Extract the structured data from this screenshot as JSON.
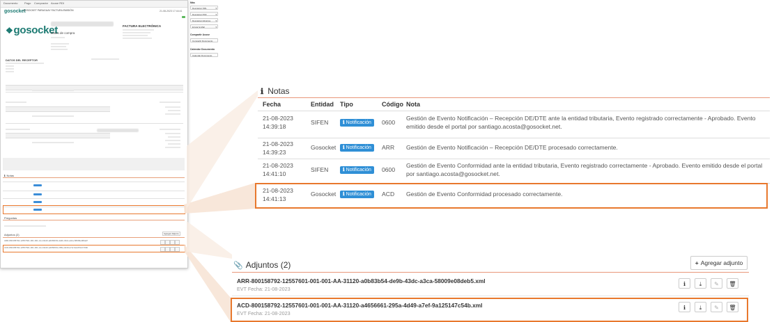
{
  "mini_page": {
    "tabs": [
      "Documento",
      "Pago",
      "Comprador",
      "Acuse RDI"
    ],
    "logo_small": "gosocket",
    "logo_large": "gosocket",
    "header_lines": [
      "GOSOCKET PARAGUAY FACTURA EMISIÓN",
      "21-08-2023 17:44:41"
    ],
    "client_title": "Datos de compra",
    "invoice_title": "FACTURA ELECTRÓNICA",
    "receiver_title": "DATOS DEL RECEPTOR",
    "notes_title": "Notas",
    "preguntas_title": "Preguntas",
    "adjuntos_title": "Adjuntos (2)",
    "add_attachment": "Agregar Adjunto",
    "file1": "ARR-800158792-12557601-001-001-AA-31120-a0b83b54-de9b-43dc-a3ca-58009e08deb5.xml",
    "file2": "ACD-800158792-12557601-001-001-AA-31120-a4656661-295a-4d49-a7ef-9a125147c54b.xml"
  },
  "sidebar": {
    "title": "Más",
    "buttons": [
      "Descargar XML",
      "Descargar PDF",
      "Descargar Adjuntos",
      "Enviar E-Mail"
    ],
    "section2_title": "Compartir Acuse",
    "section2_btn": "Compartir Documento",
    "section3_title": "Calendar Documento",
    "section3_btn": "Calendar Documento"
  },
  "notas": {
    "title": "Notas",
    "icon": "info-icon",
    "columns": [
      "Fecha",
      "Entidad",
      "Tipo",
      "Código",
      "Nota"
    ],
    "rows": [
      {
        "fecha": "21-08-2023\n14:39:18",
        "entidad": "SIFEN",
        "tipo": "Notificación",
        "codigo": "0600",
        "nota": "Gestión de Evento Notificación – Recepción DE/DTE ante la entidad tributaria, Evento registrado correctamente - Aprobado. Evento emitido desde el portal por santiago.acosta@gosocket.net."
      },
      {
        "fecha": "21-08-2023\n14:39:23",
        "entidad": "Gosocket",
        "tipo": "Notificación",
        "codigo": "ARR",
        "nota": "Gestión de Evento Notificación – Recepción DE/DTE procesado correctamente."
      },
      {
        "fecha": "21-08-2023\n14:41:10",
        "entidad": "SIFEN",
        "tipo": "Notificación",
        "codigo": "0600",
        "nota": "Gestión de Evento Conformidad ante la entidad tributaria, Evento registrado correctamente - Aprobado. Evento emitido desde el portal por santiago.acosta@gosocket.net."
      },
      {
        "fecha": "21-08-2023\n14:41:13",
        "entidad": "Gosocket",
        "tipo": "Notificación",
        "codigo": "ACD",
        "nota": "Gestión de Evento Conformidad procesado correctamente."
      }
    ]
  },
  "adjuntos": {
    "title": "Adjuntos (2)",
    "icon": "paperclip-icon",
    "add_button": "Agregar adjunto",
    "files": [
      {
        "name": "ARR-800158792-12557601-001-001-AA-31120-a0b83b54-de9b-43dc-a3ca-58009e08deb5.xml",
        "date": "EVT Fecha: 21-08-2023"
      },
      {
        "name": "ACD-800158792-12557601-001-001-AA-31120-a4656661-295a-4d49-a7ef-9a125147c54b.xml",
        "date": "EVT Fecha: 21-08-2023"
      }
    ]
  },
  "colors": {
    "accent": "#e8782d",
    "badge": "#2f8fd6",
    "brand": "#1c7a72"
  }
}
